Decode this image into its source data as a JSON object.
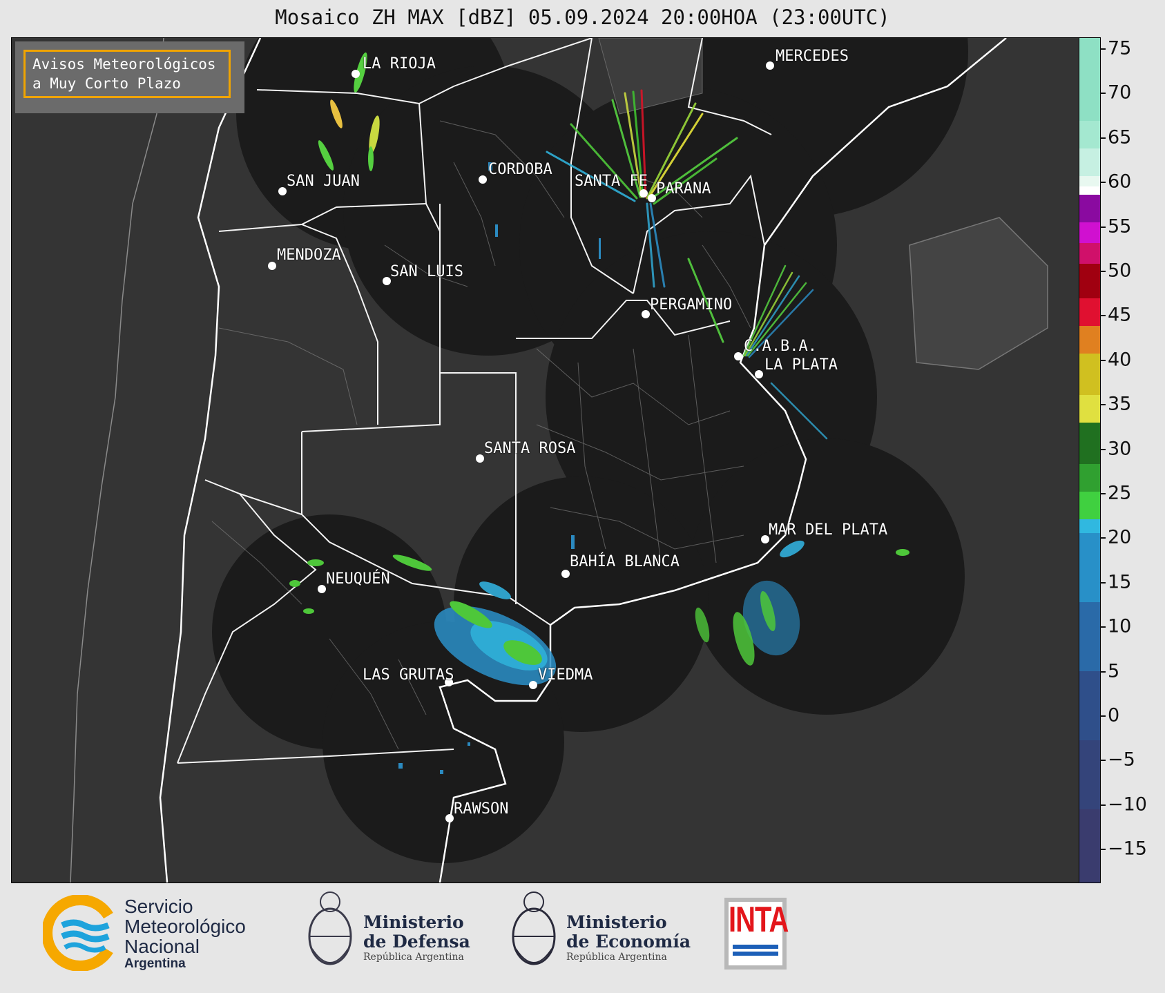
{
  "title": "Mosaico ZH MAX [dBZ] 05.09.2024 20:00HOA (23:00UTC)",
  "warning": {
    "line1": "Avisos Meteorológicos",
    "line2": "a Muy Corto Plazo"
  },
  "colorbar": {
    "ticks": [
      "75",
      "70",
      "65",
      "60",
      "55",
      "50",
      "45",
      "40",
      "35",
      "30",
      "25",
      "20",
      "15",
      "10",
      "5",
      "0",
      "−5",
      "−10",
      "−15"
    ]
  },
  "cities": [
    {
      "name": "LA RIOJA"
    },
    {
      "name": "MERCEDES"
    },
    {
      "name": "CORDOBA"
    },
    {
      "name": "SAN JUAN"
    },
    {
      "name": "SANTA FE"
    },
    {
      "name": "PARANA"
    },
    {
      "name": "MENDOZA"
    },
    {
      "name": "SAN LUIS"
    },
    {
      "name": "PERGAMINO"
    },
    {
      "name": "C.A.B.A."
    },
    {
      "name": "LA PLATA"
    },
    {
      "name": "SANTA ROSA"
    },
    {
      "name": "MAR DEL PLATA"
    },
    {
      "name": "BAHÍA BLANCA"
    },
    {
      "name": "NEUQUÉN"
    },
    {
      "name": "LAS GRUTAS"
    },
    {
      "name": "VIEDMA"
    },
    {
      "name": "RAWSON"
    }
  ],
  "logos": {
    "smn": {
      "line1": "Servicio",
      "line2": "Meteorológico",
      "line3": "Nacional",
      "line4": "Argentina"
    },
    "defensa": {
      "line1": "Ministerio",
      "line2": "de Defensa",
      "line3": "República Argentina"
    },
    "economia": {
      "line1": "Ministerio",
      "line2": "de Economía",
      "line3": "República Argentina"
    },
    "inta": {
      "label": "INTA"
    }
  },
  "colors": {
    "map_background": "#333333",
    "radar_coverage": "#1b1b1b",
    "borders": "#ffffff",
    "warning_border": "#f0a400"
  }
}
